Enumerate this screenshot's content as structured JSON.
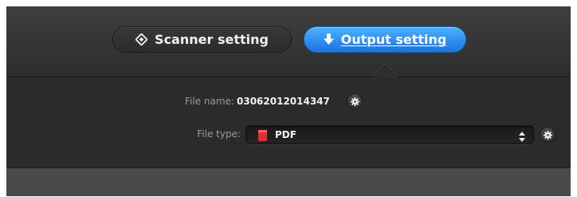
{
  "tabs": {
    "scanner": {
      "label": "Scanner setting",
      "icon": "diamond-icon"
    },
    "output": {
      "label": "Output setting",
      "icon": "download-arrow-icon",
      "active": true
    }
  },
  "form": {
    "file_name": {
      "label": "File name:",
      "value": "03062012014347",
      "settings_icon": "gear-icon"
    },
    "file_type": {
      "label": "File type:",
      "value": "PDF",
      "type_icon": "pdf-file-icon",
      "arrows_icon": "up-down-arrows-icon",
      "settings_icon": "gear-icon"
    }
  },
  "colors": {
    "accent_blue": "#2f8ff0",
    "background": "#2b2b2b",
    "pdf_red": "#e03030"
  }
}
